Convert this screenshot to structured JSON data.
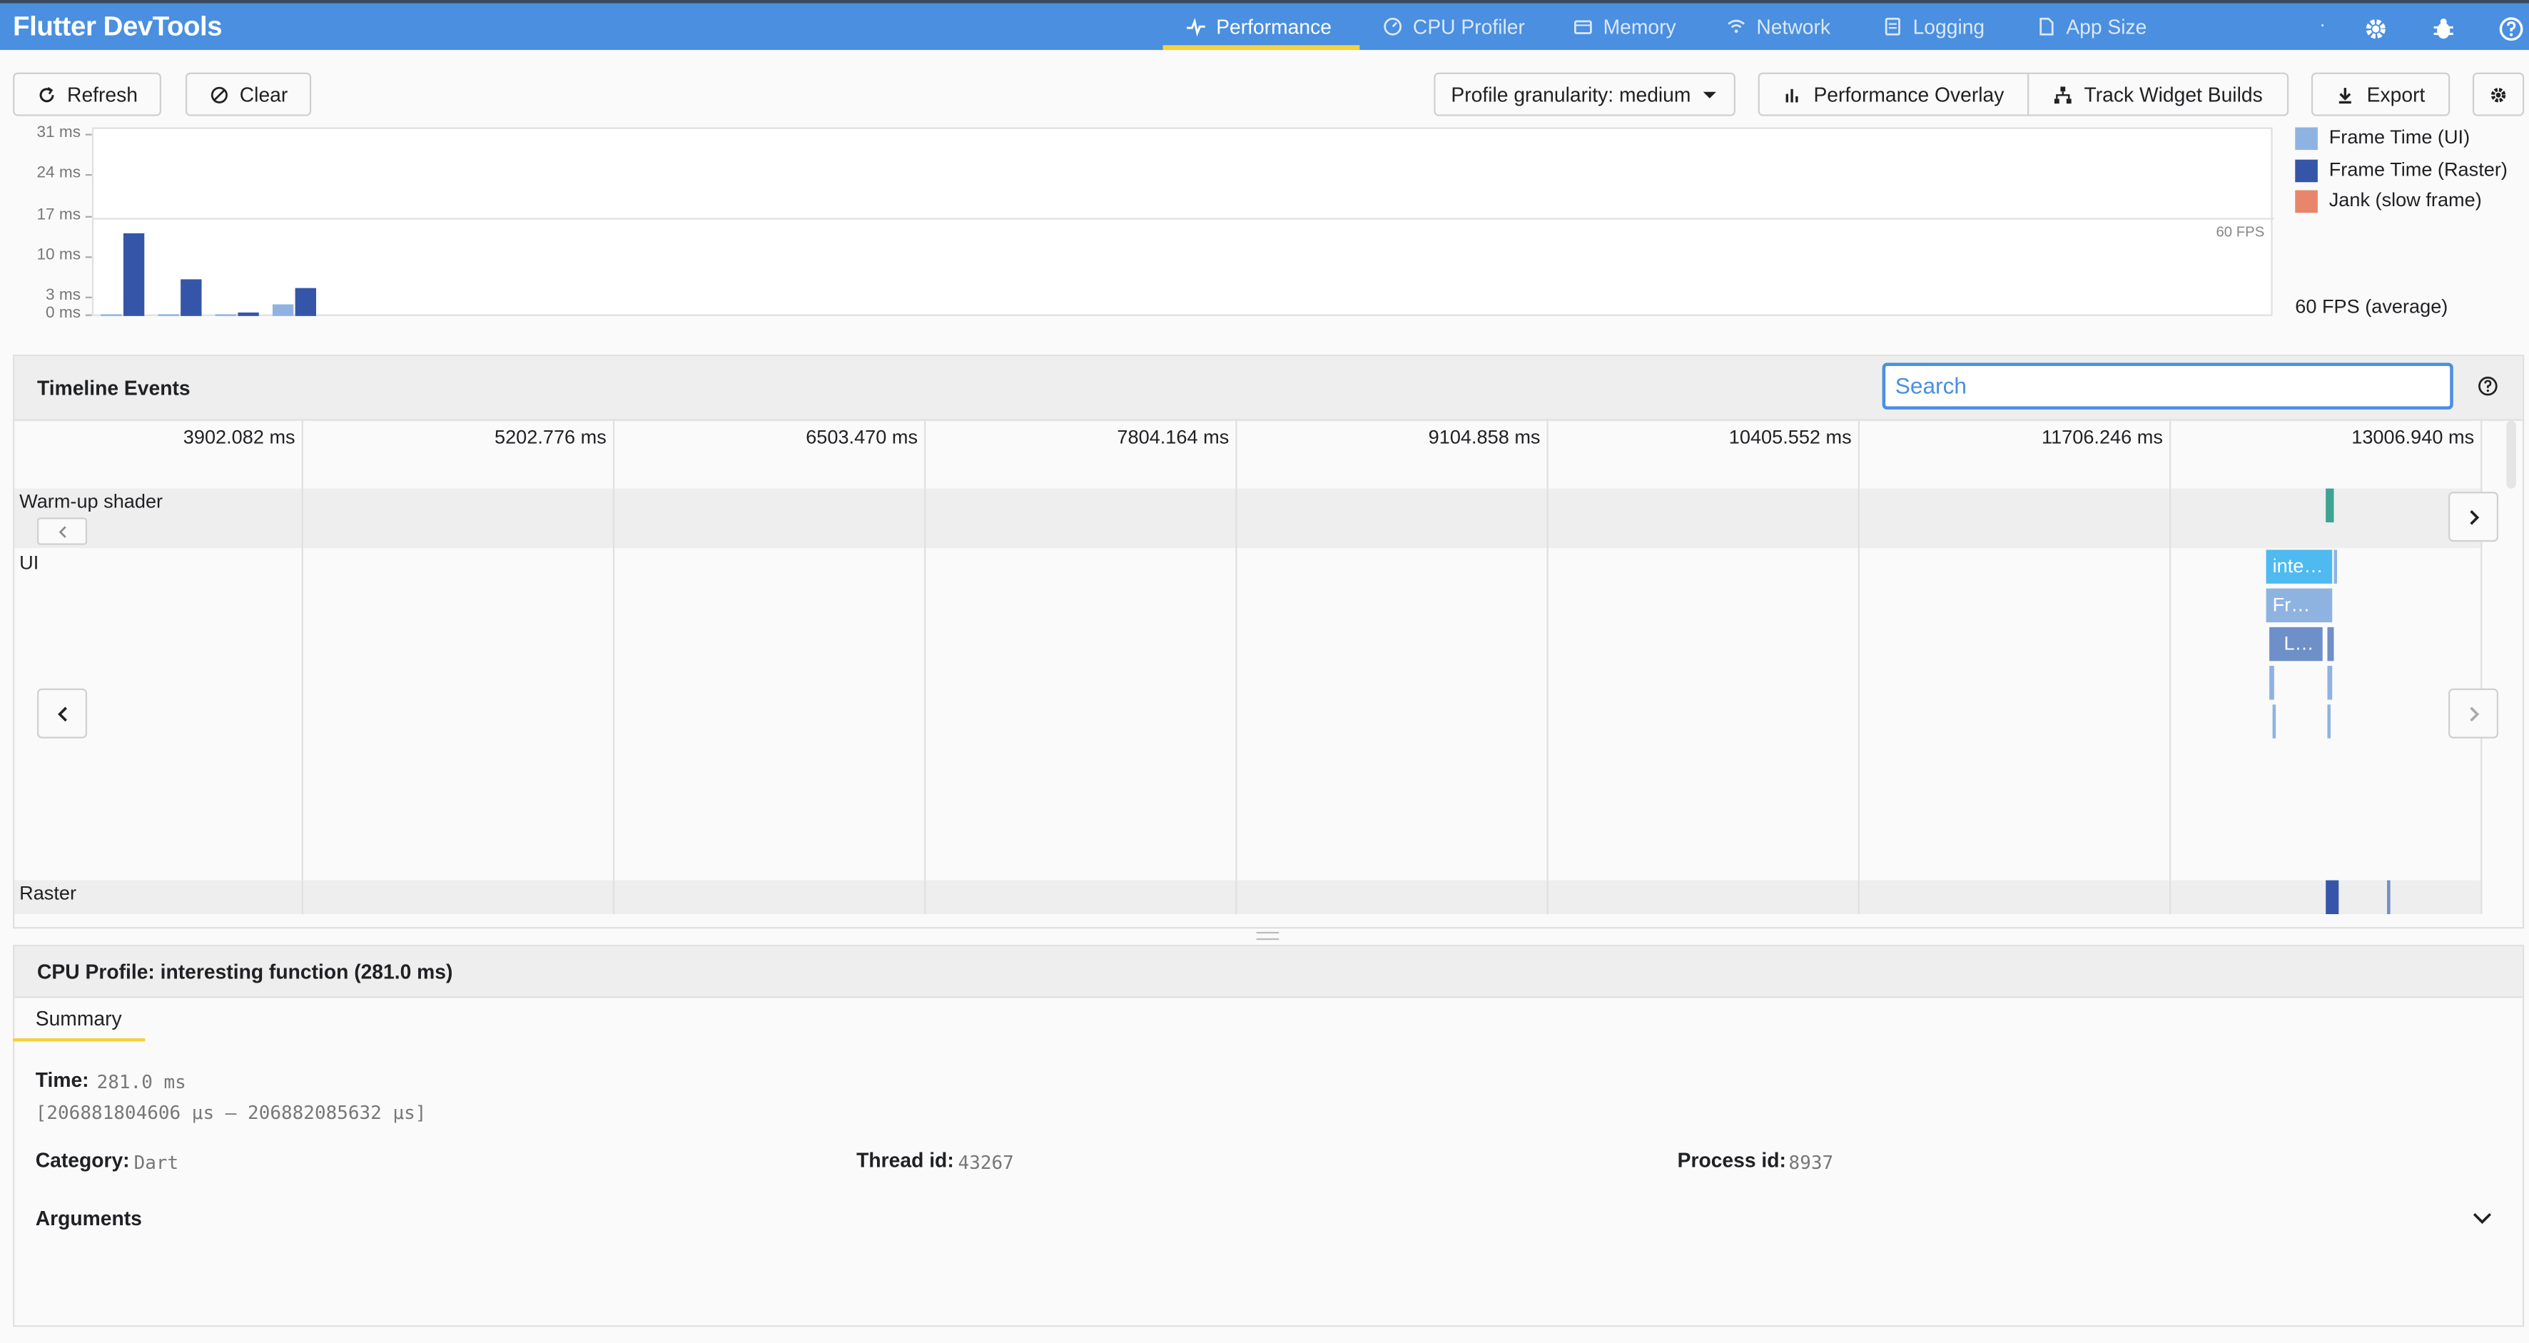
{
  "app": {
    "title": "Flutter DevTools"
  },
  "nav": {
    "tabs": [
      {
        "label": "Performance",
        "icon": "pulse-icon"
      },
      {
        "label": "CPU Profiler",
        "icon": "gauge-icon"
      },
      {
        "label": "Memory",
        "icon": "memory-icon"
      },
      {
        "label": "Network",
        "icon": "wifi-icon"
      },
      {
        "label": "Logging",
        "icon": "logging-icon"
      },
      {
        "label": "App Size",
        "icon": "file-icon"
      }
    ],
    "dot": "·",
    "right_icons": [
      "settings-icon",
      "bug-icon",
      "help-icon"
    ]
  },
  "toolbar": {
    "refresh": "Refresh",
    "clear": "Clear",
    "granularity": "Profile granularity: medium",
    "overlay": "Performance Overlay",
    "track_builds": "Track Widget Builds",
    "export": "Export"
  },
  "chart_data": {
    "type": "bar",
    "y_ticks": [
      "31 ms",
      "24 ms",
      "17 ms",
      "10 ms",
      "3 ms",
      "0 ms"
    ],
    "ylim": [
      0,
      31
    ],
    "fps_line_label": "60 FPS",
    "fps_line_value": 16.7,
    "frames": [
      {
        "ui": 0.3,
        "raster": 14.2
      },
      {
        "ui": 0.3,
        "raster": 6.3
      },
      {
        "ui": 0.3,
        "raster": 0.6
      },
      {
        "ui": 2.0,
        "raster": 4.8
      }
    ],
    "legend": [
      {
        "label": "Frame Time (UI)",
        "color": "#8fb3e1"
      },
      {
        "label": "Frame Time (Raster)",
        "color": "#3556a8"
      },
      {
        "label": "Jank (slow frame)",
        "color": "#e8866c"
      }
    ],
    "average": "60 FPS (average)"
  },
  "timeline": {
    "title": "Timeline Events",
    "search_placeholder": "Search",
    "ticks": [
      "3902.082 ms",
      "5202.776 ms",
      "6503.470 ms",
      "7804.164 ms",
      "9104.858 ms",
      "10405.552 ms",
      "11706.246 ms",
      "13006.940 ms"
    ],
    "lanes": {
      "warmup": "Warm-up shader",
      "ui": "UI",
      "raster": "Raster"
    },
    "events": {
      "e1": "inte…",
      "e2": "Fr…",
      "e3": "L…"
    }
  },
  "details": {
    "title": "CPU Profile: interesting function (281.0 ms)",
    "tab": "Summary",
    "time_label": "Time:",
    "time_value": "281.0 ms",
    "range": "[206881804606 μs —  206882085632 μs]",
    "category_label": "Category:",
    "category_value": "Dart",
    "thread_label": "Thread id:",
    "thread_value": "43267",
    "process_label": "Process id:",
    "process_value": "8937",
    "arguments_label": "Arguments"
  }
}
